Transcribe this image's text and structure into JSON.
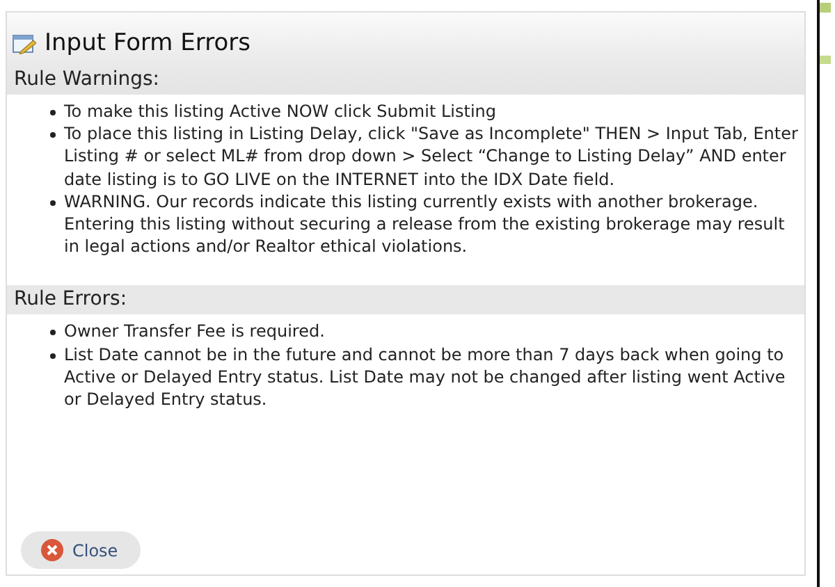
{
  "dialog": {
    "title": "Input Form Errors",
    "sections": [
      {
        "heading": "Rule Warnings:",
        "items": [
          "To make this listing Active NOW click Submit Listing",
          "To place this listing in Listing Delay, click \"Save as Incomplete\" THEN > Input Tab, Enter Listing # or select ML# from drop down > Select “Change to Listing Delay” AND enter date listing is to GO LIVE on the INTERNET into the IDX Date field.",
          "WARNING. Our records indicate this listing currently exists with another brokerage. Entering this listing without securing a release from the existing brokerage may result in legal actions and/or Realtor ethical violations."
        ]
      },
      {
        "heading": "Rule Errors:",
        "items": [
          "Owner Transfer Fee is required.",
          "List Date cannot be in the future and cannot be more than 7 days back when going to Active or Delayed Entry status. List Date may not be changed after listing went Active or Delayed Entry status."
        ]
      }
    ],
    "close_button": "Close"
  }
}
